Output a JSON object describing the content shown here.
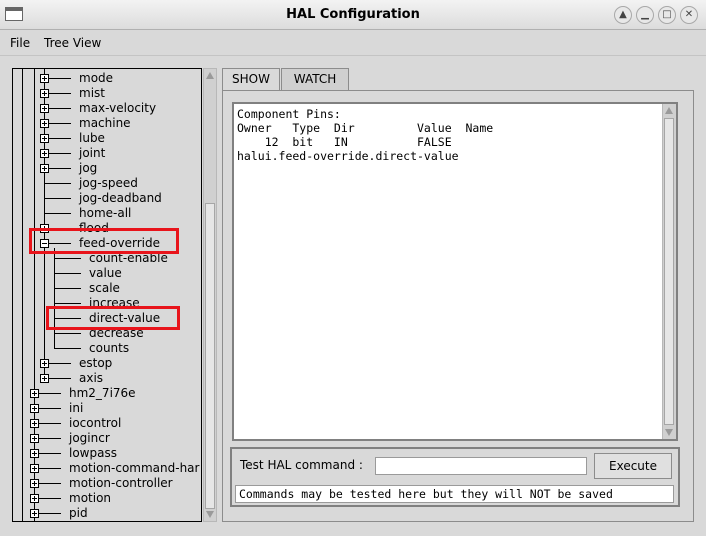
{
  "window": {
    "title": "HAL Configuration"
  },
  "menu": [
    "File",
    "Tree View"
  ],
  "tree": {
    "items": [
      {
        "label": "mode",
        "level": 2,
        "expander": "plus"
      },
      {
        "label": "mist",
        "level": 2,
        "expander": "plus"
      },
      {
        "label": "max-velocity",
        "level": 2,
        "expander": "plus"
      },
      {
        "label": "machine",
        "level": 2,
        "expander": "plus"
      },
      {
        "label": "lube",
        "level": 2,
        "expander": "plus"
      },
      {
        "label": "joint",
        "level": 2,
        "expander": "plus"
      },
      {
        "label": "jog",
        "level": 2,
        "expander": "plus"
      },
      {
        "label": "jog-speed",
        "level": 2,
        "expander": "none"
      },
      {
        "label": "jog-deadband",
        "level": 2,
        "expander": "none"
      },
      {
        "label": "home-all",
        "level": 2,
        "expander": "none"
      },
      {
        "label": "flood",
        "level": 2,
        "expander": "plus"
      },
      {
        "label": "feed-override",
        "level": 2,
        "expander": "minus",
        "highlighted": true
      },
      {
        "label": "count-enable",
        "level": 3,
        "expander": "none"
      },
      {
        "label": "value",
        "level": 3,
        "expander": "none"
      },
      {
        "label": "scale",
        "level": 3,
        "expander": "none"
      },
      {
        "label": "increase",
        "level": 3,
        "expander": "none"
      },
      {
        "label": "direct-value",
        "level": 3,
        "expander": "none",
        "highlighted": true
      },
      {
        "label": "decrease",
        "level": 3,
        "expander": "none"
      },
      {
        "label": "counts",
        "level": 3,
        "expander": "none"
      },
      {
        "label": "estop",
        "level": 2,
        "expander": "plus"
      },
      {
        "label": "axis",
        "level": 2,
        "expander": "plus"
      },
      {
        "label": "hm2_7i76e",
        "level": 1,
        "expander": "plus"
      },
      {
        "label": "ini",
        "level": 1,
        "expander": "plus"
      },
      {
        "label": "iocontrol",
        "level": 1,
        "expander": "plus"
      },
      {
        "label": "jogincr",
        "level": 1,
        "expander": "plus"
      },
      {
        "label": "lowpass",
        "level": 1,
        "expander": "plus"
      },
      {
        "label": "motion-command-har",
        "level": 1,
        "expander": "plus"
      },
      {
        "label": "motion-controller",
        "level": 1,
        "expander": "plus"
      },
      {
        "label": "motion",
        "level": 1,
        "expander": "plus"
      },
      {
        "label": "pid",
        "level": 1,
        "expander": "plus"
      }
    ]
  },
  "tabs": [
    {
      "label": "SHOW",
      "active": true
    },
    {
      "label": "WATCH",
      "active": false
    }
  ],
  "show_text": {
    "lines": [
      "Component Pins:",
      "Owner   Type  Dir         Value  Name",
      "    12  bit   IN          FALSE",
      "halui.feed-override.direct-value"
    ]
  },
  "command": {
    "label": "Test HAL command :",
    "input_value": "",
    "execute_label": "Execute",
    "status": "Commands may be tested here but they will NOT be saved"
  },
  "annotation_color": "#e8141b"
}
